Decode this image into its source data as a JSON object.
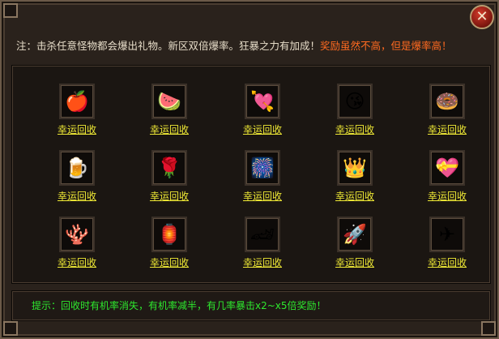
{
  "notice": {
    "prefix": "注：击杀任意怪物都会爆出礼物。新区双倍爆率。狂暴之力有加成！",
    "highlight": "奖励虽然不高，但是爆率高！"
  },
  "close_label": "✕",
  "items": [
    {
      "icon": "🍎",
      "icon_name": "candy-apple-icon",
      "label": "幸运回收"
    },
    {
      "icon": "🍉",
      "icon_name": "watermelon-icon",
      "label": "幸运回收"
    },
    {
      "icon": "💘",
      "icon_name": "winged-heart-icon",
      "label": "幸运回收"
    },
    {
      "icon": "😘",
      "icon_name": "kiss-face-icon",
      "label": "幸运回收"
    },
    {
      "icon": "🍩",
      "icon_name": "donut-icon",
      "label": "幸运回收"
    },
    {
      "icon": "🍺",
      "icon_name": "beer-mug-icon",
      "label": "幸运回收"
    },
    {
      "icon": "🌹",
      "icon_name": "rose-icon",
      "label": "幸运回收"
    },
    {
      "icon": "🎆",
      "icon_name": "firework-icon",
      "label": "幸运回收"
    },
    {
      "icon": "👑",
      "icon_name": "crown-icon",
      "label": "幸运回收"
    },
    {
      "icon": "💝",
      "icon_name": "love-heart-icon",
      "label": "幸运回收"
    },
    {
      "icon": "🪸",
      "icon_name": "red-coral-icon",
      "label": "幸运回收"
    },
    {
      "icon": "🏮",
      "icon_name": "lantern-icon",
      "label": "幸运回收"
    },
    {
      "icon": "🏎",
      "icon_name": "sports-car-icon",
      "label": "幸运回收"
    },
    {
      "icon": "🚀",
      "icon_name": "rocket-icon",
      "label": "幸运回收"
    },
    {
      "icon": "✈",
      "icon_name": "jet-plane-icon",
      "label": "幸运回收"
    }
  ],
  "tip": "提示：回收时有机率消失，有机率减半，有几率暴击x2~x5倍奖励！"
}
